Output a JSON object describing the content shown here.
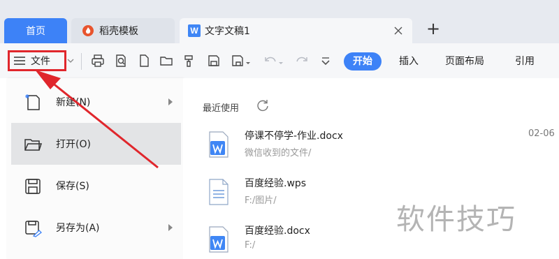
{
  "tabs": {
    "home": "首页",
    "docer": "稻壳模板",
    "document": "文字文稿1",
    "document_logo": "W"
  },
  "toolbar": {
    "file_label": "文件",
    "ribbon_tabs": [
      "开始",
      "插入",
      "页面布局",
      "引用"
    ]
  },
  "file_menu": {
    "items": [
      {
        "label": "新建(N)",
        "icon": "new-file-icon",
        "has_submenu": true
      },
      {
        "label": "打开(O)",
        "icon": "folder-open-icon",
        "has_submenu": false,
        "highlighted": true
      },
      {
        "label": "保存(S)",
        "icon": "save-icon",
        "has_submenu": false
      },
      {
        "label": "另存为(A)",
        "icon": "save-as-icon",
        "has_submenu": true
      }
    ]
  },
  "recent": {
    "title": "最近使用",
    "files": [
      {
        "name": "停课不停学-作业.docx",
        "path": "微信收到的文件/",
        "date": "02-06",
        "type": "docx"
      },
      {
        "name": "百度经验.wps",
        "path": "F:/图片/",
        "date": "",
        "type": "wps"
      },
      {
        "name": "百度经验.docx",
        "path": "F:/",
        "date": "",
        "type": "docx"
      }
    ]
  },
  "watermark": "软件技巧",
  "colors": {
    "accent": "#3d82f7",
    "annotation_red": "#e0262c",
    "tab_bar_bg": "#e7eaf0"
  }
}
